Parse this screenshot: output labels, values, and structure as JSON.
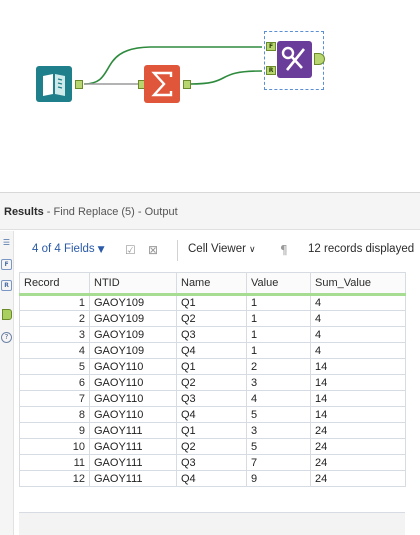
{
  "canvas": {
    "tools": [
      {
        "name": "input-data-tool",
        "icon": "book-icon",
        "color": "#1f7f8a"
      },
      {
        "name": "summarize-tool",
        "icon": "sigma-icon",
        "color": "#e0563a"
      },
      {
        "name": "find-replace-tool",
        "icon": "percent-icon",
        "color": "#6a3d9a",
        "input_labels": [
          "F",
          "R"
        ]
      }
    ],
    "wire_color": "#2e8b3e"
  },
  "results": {
    "title_bold": "Results",
    "title_rest": " - Find Replace (5) - Output",
    "fields_label": "4 of 4 Fields",
    "cell_viewer_label": "Cell Viewer",
    "records_label": "12 records displayed"
  },
  "rail": {
    "f_label": "F",
    "r_label": "R",
    "help": "?"
  },
  "table": {
    "headers": [
      "Record",
      "NTID",
      "Name",
      "Value",
      "Sum_Value"
    ],
    "rows": [
      [
        "1",
        "GAOY109",
        "Q1",
        "1",
        "4"
      ],
      [
        "2",
        "GAOY109",
        "Q2",
        "1",
        "4"
      ],
      [
        "3",
        "GAOY109",
        "Q3",
        "1",
        "4"
      ],
      [
        "4",
        "GAOY109",
        "Q4",
        "1",
        "4"
      ],
      [
        "5",
        "GAOY110",
        "Q1",
        "2",
        "14"
      ],
      [
        "6",
        "GAOY110",
        "Q2",
        "3",
        "14"
      ],
      [
        "7",
        "GAOY110",
        "Q3",
        "4",
        "14"
      ],
      [
        "8",
        "GAOY110",
        "Q4",
        "5",
        "14"
      ],
      [
        "9",
        "GAOY111",
        "Q1",
        "3",
        "24"
      ],
      [
        "10",
        "GAOY111",
        "Q2",
        "5",
        "24"
      ],
      [
        "11",
        "GAOY111",
        "Q3",
        "7",
        "24"
      ],
      [
        "12",
        "GAOY111",
        "Q4",
        "9",
        "24"
      ]
    ]
  }
}
